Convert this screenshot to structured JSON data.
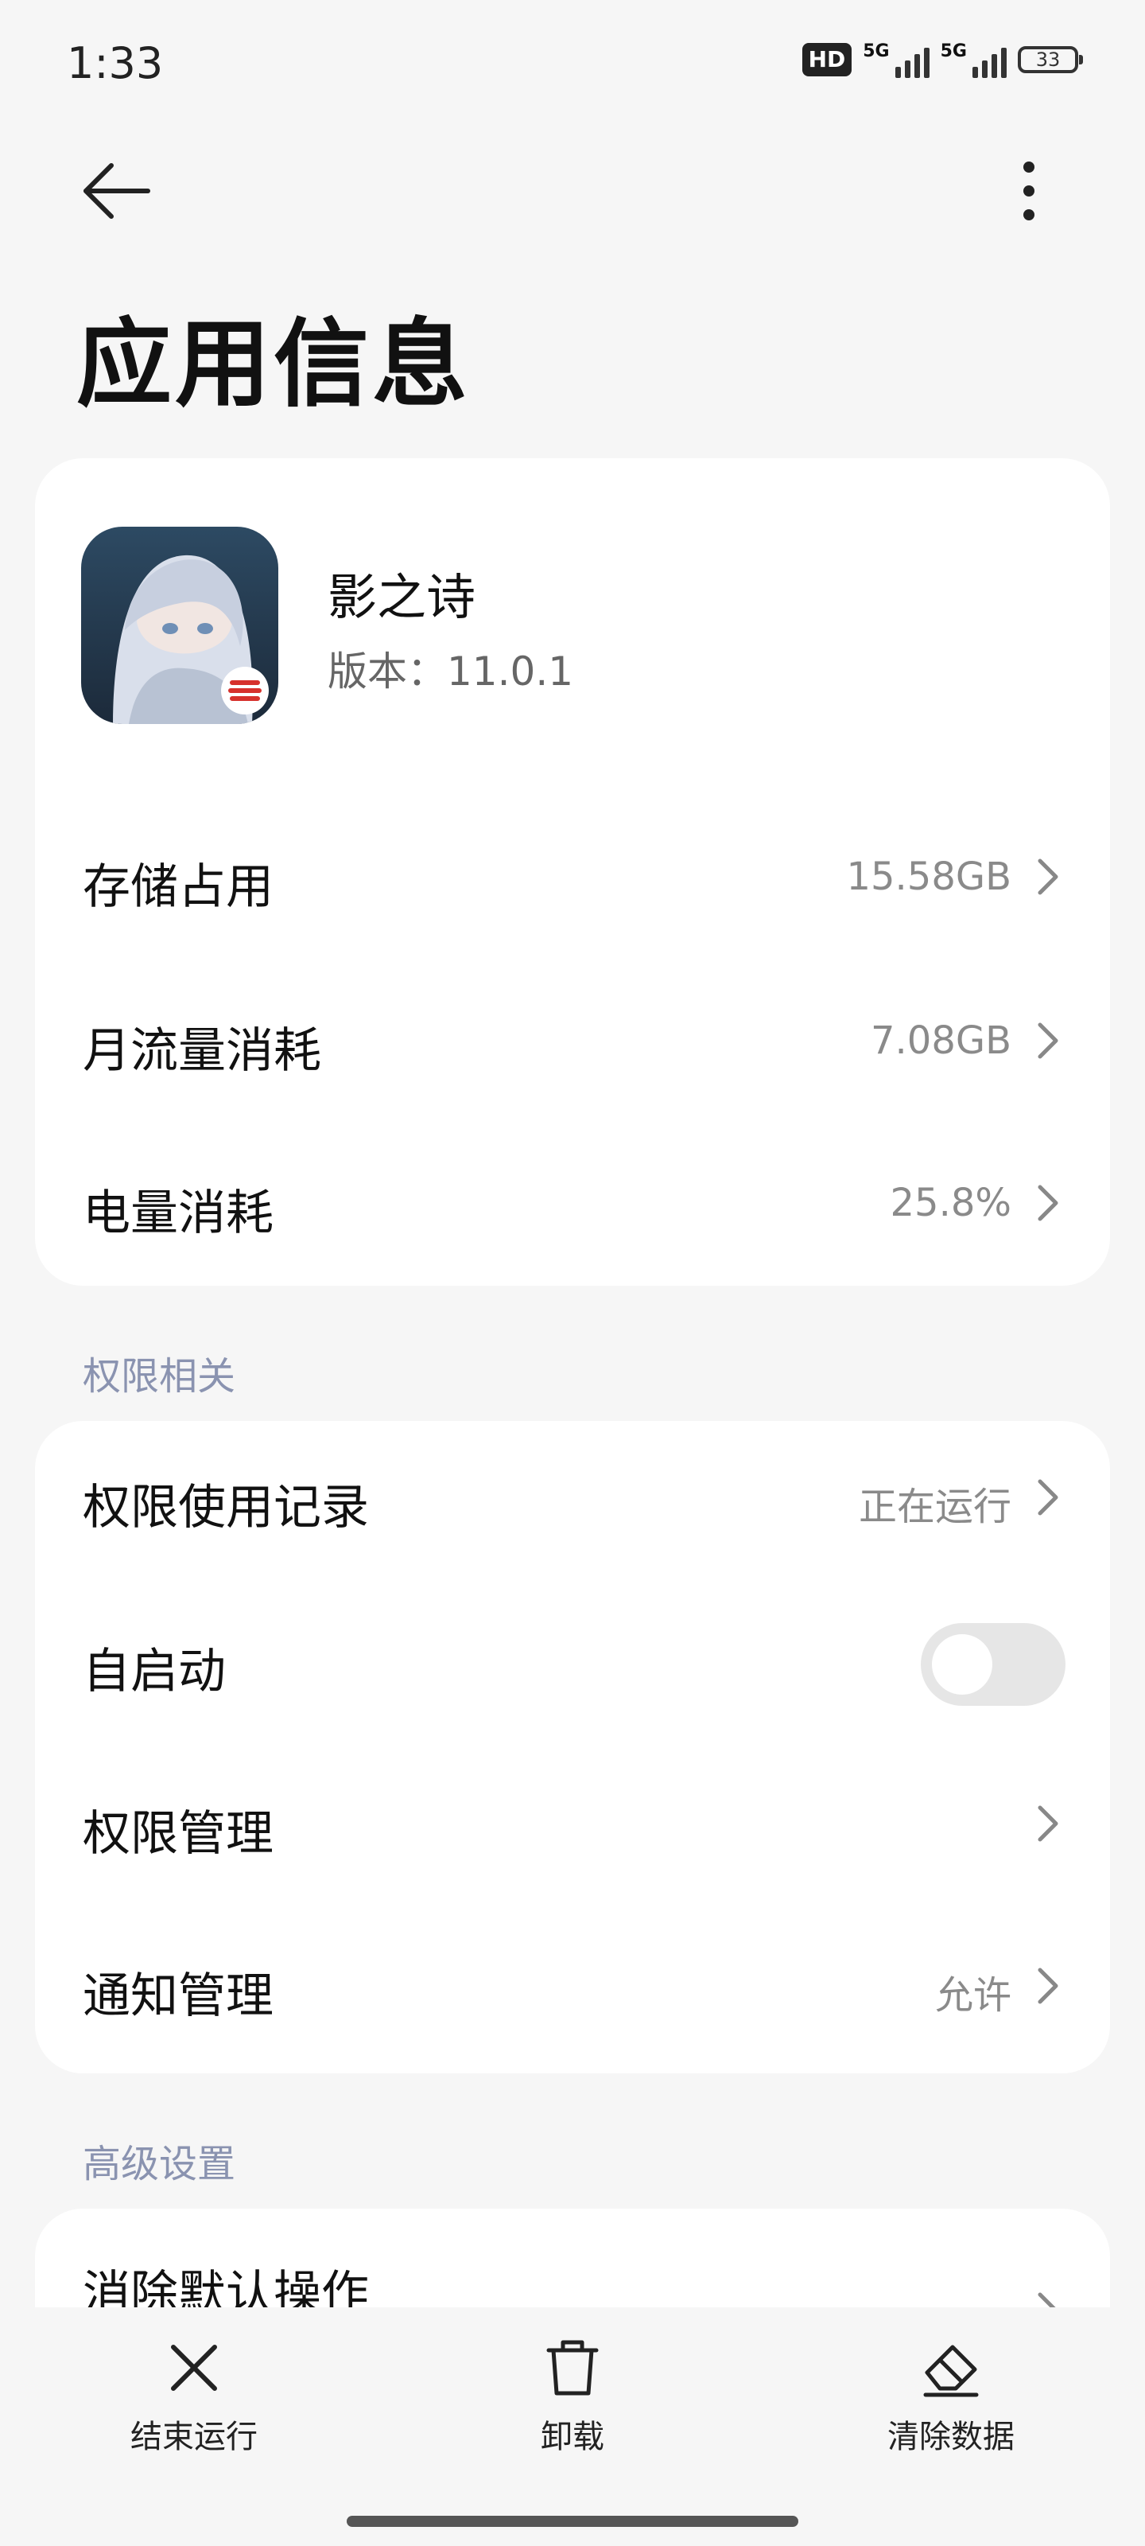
{
  "status_bar": {
    "time": "1:33",
    "hd_label": "HD",
    "net1": "5G",
    "net2": "5G",
    "battery": "33"
  },
  "header": {
    "title": "应用信息",
    "back_icon": "arrow-left-icon",
    "more_icon": "more-vertical-icon"
  },
  "app": {
    "name": "影之诗",
    "version": "版本：11.0.1",
    "icon": "app-icon"
  },
  "usage": [
    {
      "label": "存储占用",
      "value": "15.58GB"
    },
    {
      "label": "月流量消耗",
      "value": "7.08GB"
    },
    {
      "label": "电量消耗",
      "value": "25.8%"
    }
  ],
  "permissions": {
    "header": "权限相关",
    "items": [
      {
        "label": "权限使用记录",
        "value": "正在运行"
      },
      {
        "label": "自启动",
        "toggle": false
      },
      {
        "label": "权限管理",
        "value": ""
      },
      {
        "label": "通知管理",
        "value": "允许"
      }
    ]
  },
  "advanced": {
    "header": "高级设置",
    "items": [
      {
        "label": "消除默认操作"
      }
    ]
  },
  "bottom_actions": [
    {
      "label": "结束运行",
      "icon": "close-icon"
    },
    {
      "label": "卸载",
      "icon": "trash-icon"
    },
    {
      "label": "清除数据",
      "icon": "eraser-icon"
    }
  ],
  "colors": {
    "background": "#f6f6f6",
    "card": "#ffffff",
    "section_header": "#8a93b0",
    "secondary_text": "#8a8a8a"
  }
}
